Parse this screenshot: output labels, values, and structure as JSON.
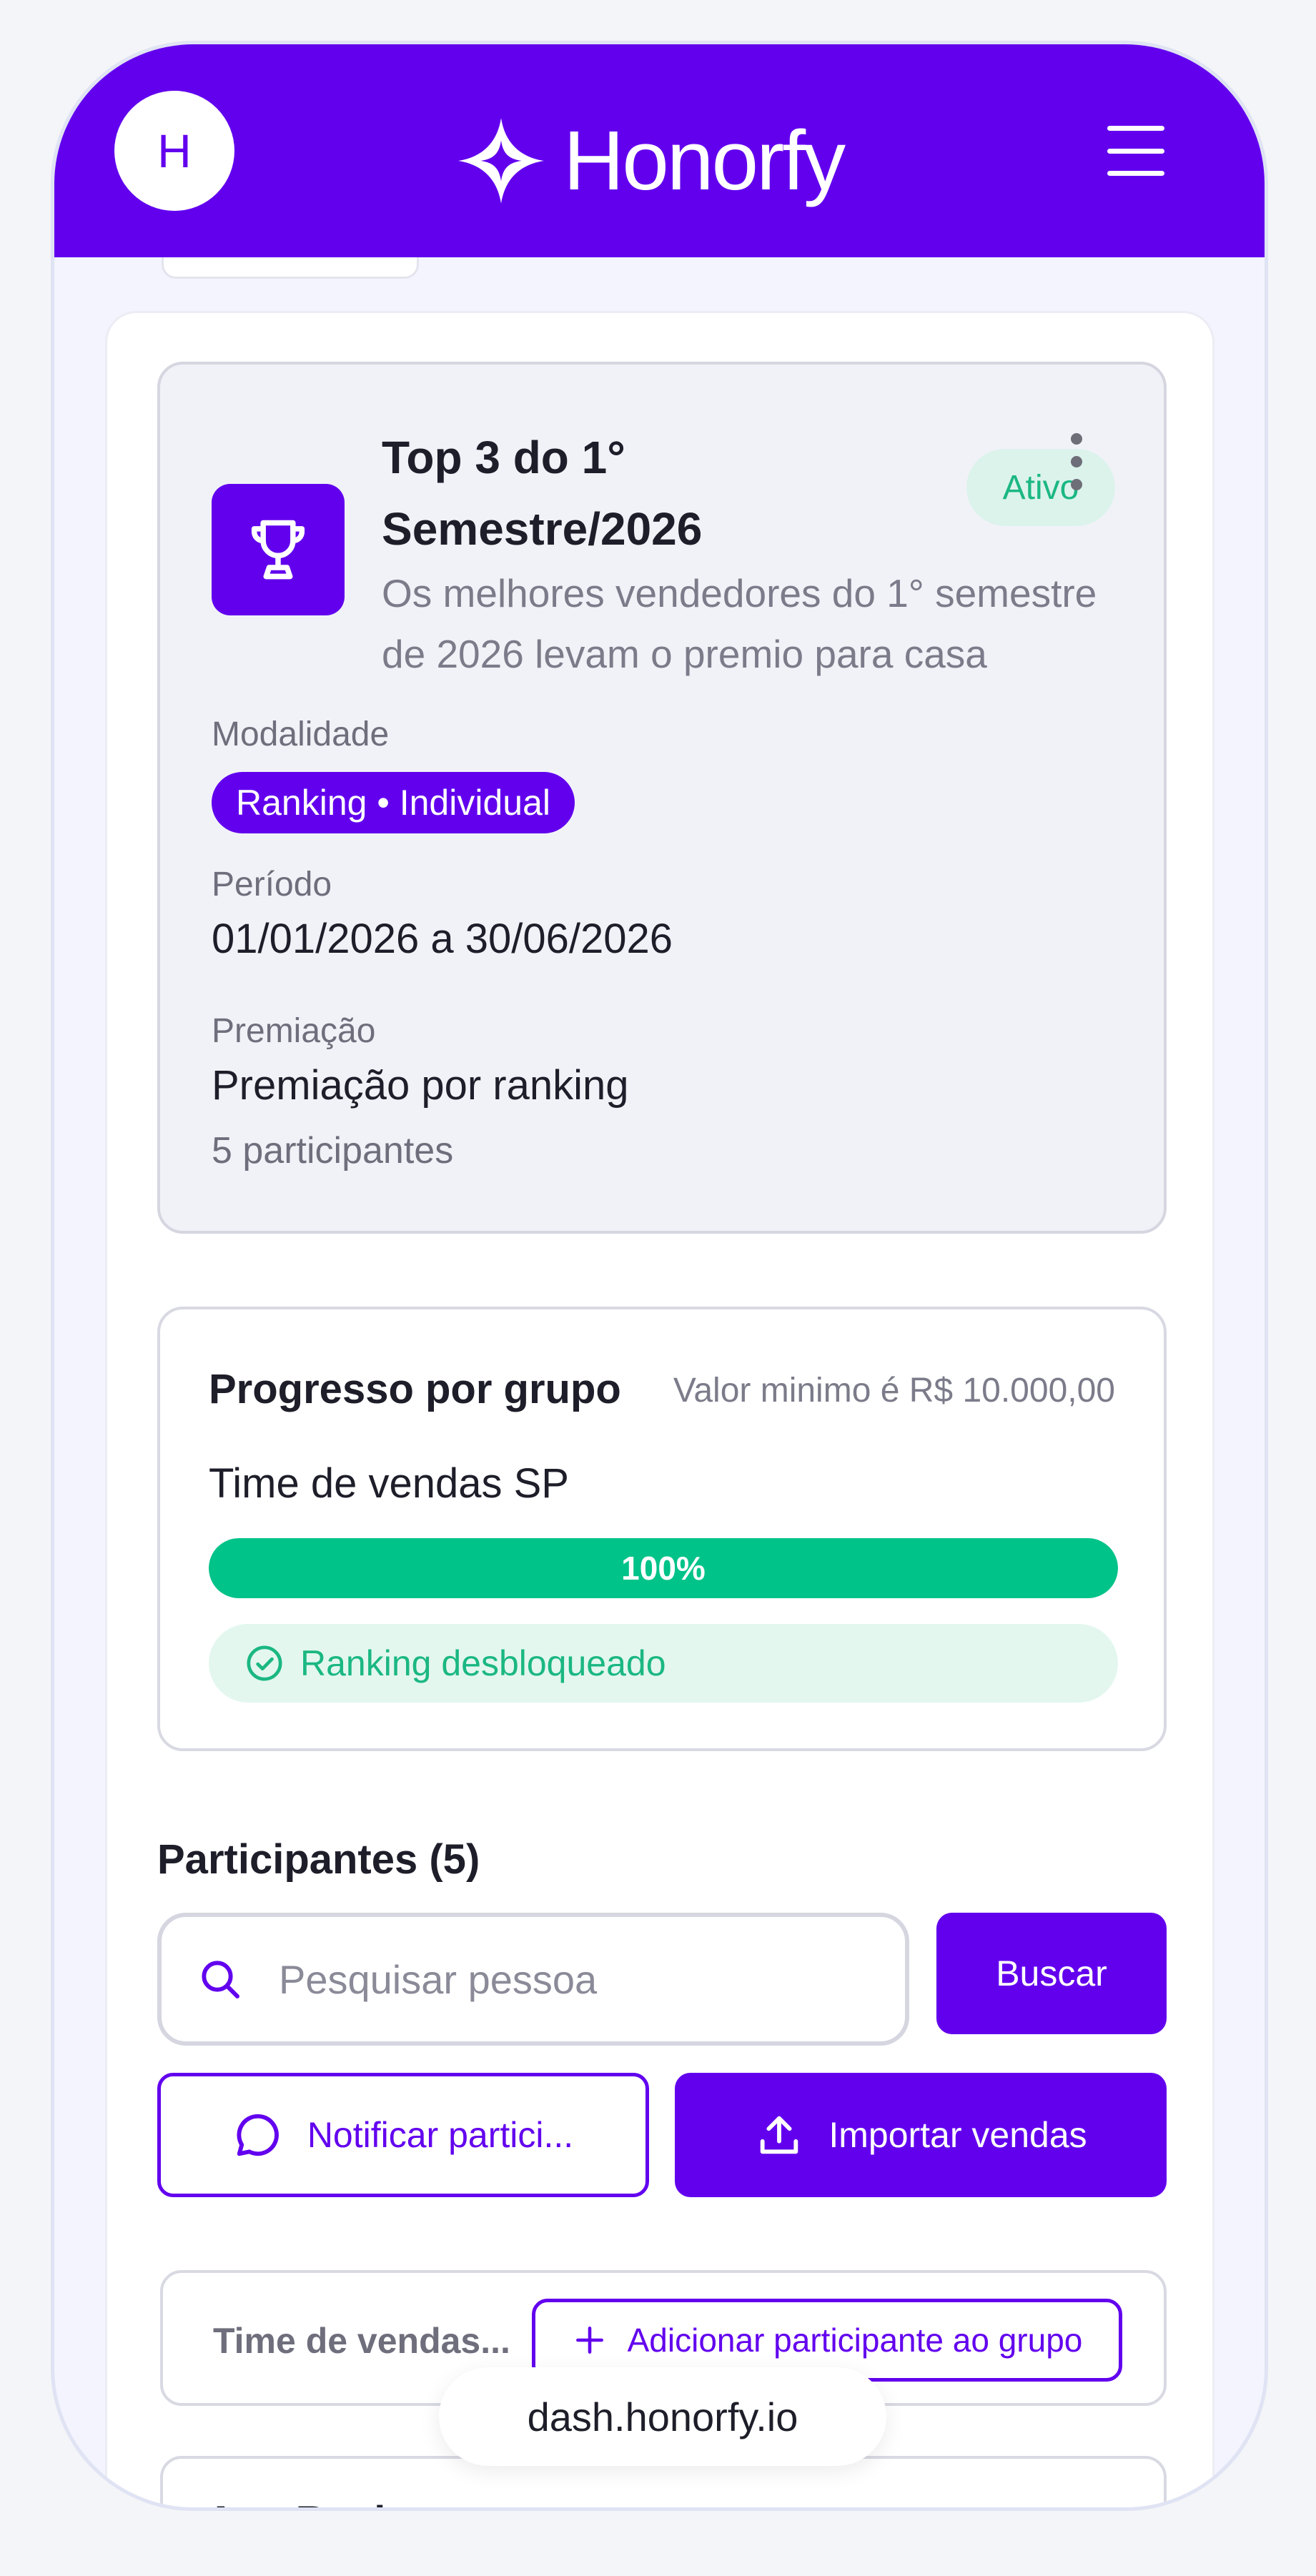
{
  "header": {
    "avatar_initial": "H",
    "brand_name": "Honorfy"
  },
  "contest": {
    "title": "Top 3 do 1° Semestre/2026",
    "description": "Os melhores vendedores do 1° semestre de 2026 levam o premio para casa",
    "status": "Ativo",
    "modality_label": "Modalidade",
    "modality_value": "Ranking • Individual",
    "period_label": "Período",
    "period_value": "01/01/2026 a 30/06/2026",
    "prize_label": "Premiação",
    "prize_value": "Premiação por ranking",
    "participants_count": "5 participantes"
  },
  "progress": {
    "title": "Progresso por grupo",
    "minimum": "Valor minimo é R$ 10.000,00",
    "group_name": "Time de vendas SP",
    "percent_label": "100%",
    "percent": 1.0,
    "unlocked_text": "Ranking desbloqueado"
  },
  "participants": {
    "title": "Participantes (5)",
    "search_placeholder": "Pesquisar pessoa",
    "search_button": "Buscar",
    "notify_button": "Notificar partici...",
    "import_button": "Importar vendas",
    "group_name": "Time de vendas...",
    "add_button": "Adicionar participante ao grupo",
    "next_name": "Ana Rosi..."
  },
  "browser": {
    "url": "dash.honorfy.io"
  },
  "colors": {
    "primary": "#6200ee",
    "success": "#00c389",
    "success_bg": "#e3f7ef"
  }
}
